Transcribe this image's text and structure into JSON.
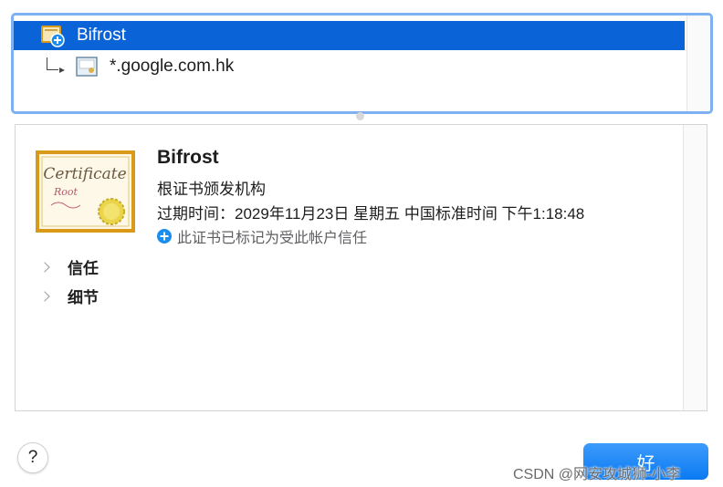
{
  "tree": {
    "root": {
      "label": "Bifrost",
      "icon": "root-certificate-icon"
    },
    "child": {
      "label": "*.google.com.hk",
      "icon": "certificate-icon"
    }
  },
  "detail": {
    "name": "Bifrost",
    "kind": "根证书颁发机构",
    "expiry": "过期时间：2029年11月23日 星期五 中国标准时间 下午1:18:48",
    "trust_status": "此证书已标记为受此帐户信任",
    "certificate_image": {
      "title": "Certificate",
      "subtitle": "Root"
    },
    "sections": [
      {
        "label": "信任"
      },
      {
        "label": "细节"
      }
    ]
  },
  "footer": {
    "help_label": "?",
    "ok_label": "好",
    "watermark": "CSDN @网安攻城狮-小李"
  },
  "colors": {
    "selection": "#0b63d8",
    "focus_ring": "#7fb0f2",
    "accent": "#1a8ef0",
    "certificate_frame": "#d99a1a"
  }
}
